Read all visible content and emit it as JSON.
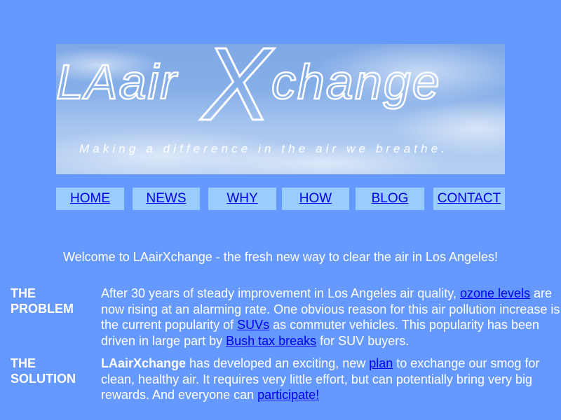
{
  "banner": {
    "logo_text": "LAairXchange",
    "logo_prefix": "LAair",
    "logo_x": "X",
    "logo_suffix": "change",
    "tagline": "Making a difference in the air we breathe."
  },
  "nav": {
    "items": [
      {
        "label": "HOME"
      },
      {
        "label": "NEWS"
      },
      {
        "label": "WHY"
      },
      {
        "label": "HOW"
      },
      {
        "label": "BLOG"
      },
      {
        "label": "CONTACT"
      }
    ]
  },
  "welcome": "Welcome to LAairXchange - the fresh new way to clear the air in Los Angeles!",
  "problem": {
    "label_line1": "THE",
    "label_line2": "PROBLEM",
    "text1": "After 30 years of steady improvement in Los Angeles air quality, ",
    "link1": "ozone levels",
    "text2": " are now rising at an alarming rate. One obvious reason for this air pollution increase is the current popularity of ",
    "link2": "SUVs",
    "text3": " as commuter vehicles. This popularity has been driven in large part by ",
    "link3": "Bush tax breaks",
    "text4": " for SUV buyers."
  },
  "solution": {
    "label_line1": "THE",
    "label_line2": "SOLUTION",
    "bold": "LAairXchange",
    "text1": " has developed an exciting, new ",
    "link1": "plan",
    "text2": " to exchange our smog for clean, healthy air. It requires very little effort, but can potentially bring very big rewards. And everyone can ",
    "link2": "participate!"
  },
  "colors": {
    "background": "#6699ff",
    "nav_button": "#99ccff",
    "link": "#0000ee"
  }
}
